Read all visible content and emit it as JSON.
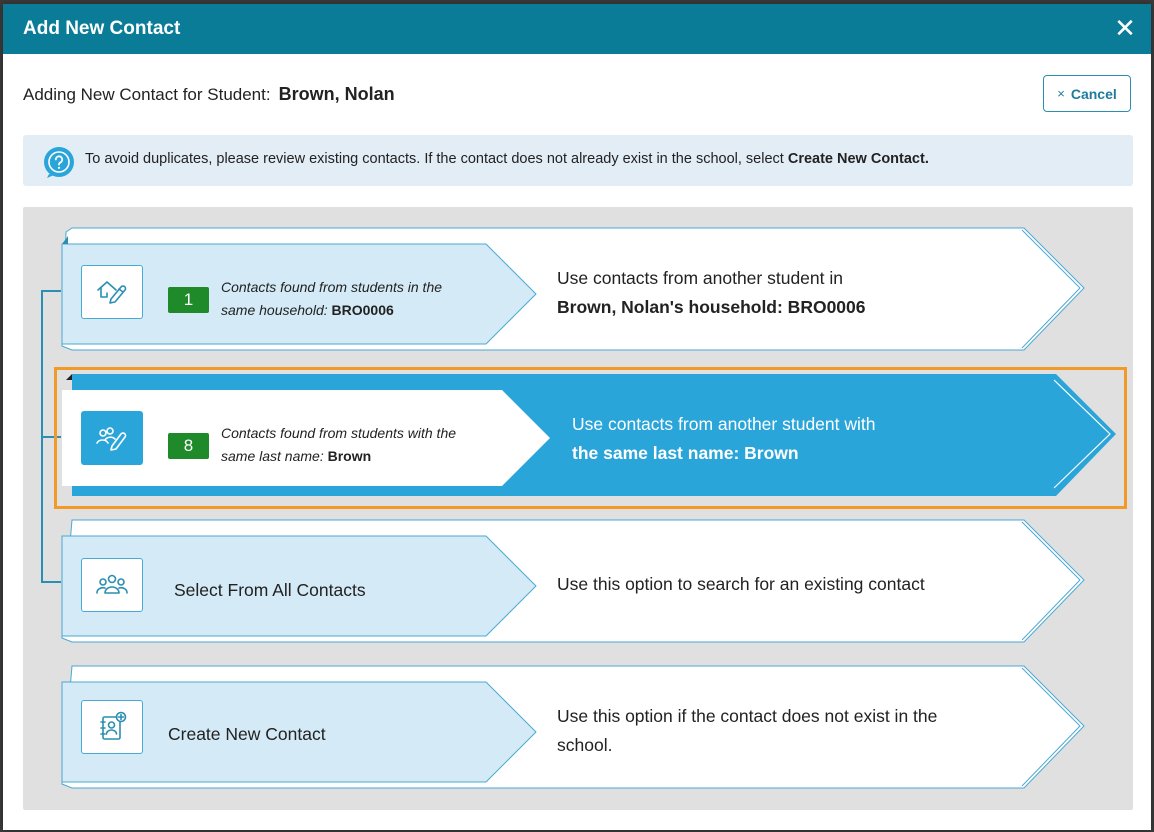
{
  "header": {
    "title": "Add New Contact",
    "close_label": "✕"
  },
  "subtitle": {
    "label": "Adding New Contact for Student:",
    "student_name": "Brown, Nolan"
  },
  "cancel": {
    "icon": "×",
    "label": "Cancel"
  },
  "info": {
    "text": "To avoid duplicates, please review existing contacts. If the contact does not already exist in the school, select ",
    "bold": "Create New Contact."
  },
  "options": [
    {
      "icon": "household-contact-icon",
      "count": "1",
      "desc_line1": "Contacts found from students in the",
      "desc_line2_prefix": "same household:",
      "desc_line2_bold": "BRO0006",
      "right_line1": "Use contacts from another student in",
      "right_line2": "Brown, Nolan's household: BRO0006"
    },
    {
      "icon": "people-contact-icon",
      "count": "8",
      "desc_line1": "Contacts found from students with the",
      "desc_line2_prefix": "same last name:",
      "desc_line2_bold": "Brown",
      "right_line1": "Use contacts from another student with",
      "right_line2": "the same last name: Brown"
    },
    {
      "icon": "group-icon",
      "label": "Select From All Contacts",
      "right_line1": "Use this option to search for an existing contact"
    },
    {
      "icon": "contact-book-add-icon",
      "label": "Create New Contact",
      "right_line1": "Use this option if the contact does not exist in the",
      "right_line2": "school."
    }
  ],
  "colors": {
    "header": "#0a7c97",
    "active": "#2aa5d9",
    "badge": "#1e8a2a",
    "highlight": "#f29a27",
    "light_blue": "#d4eaf6"
  }
}
